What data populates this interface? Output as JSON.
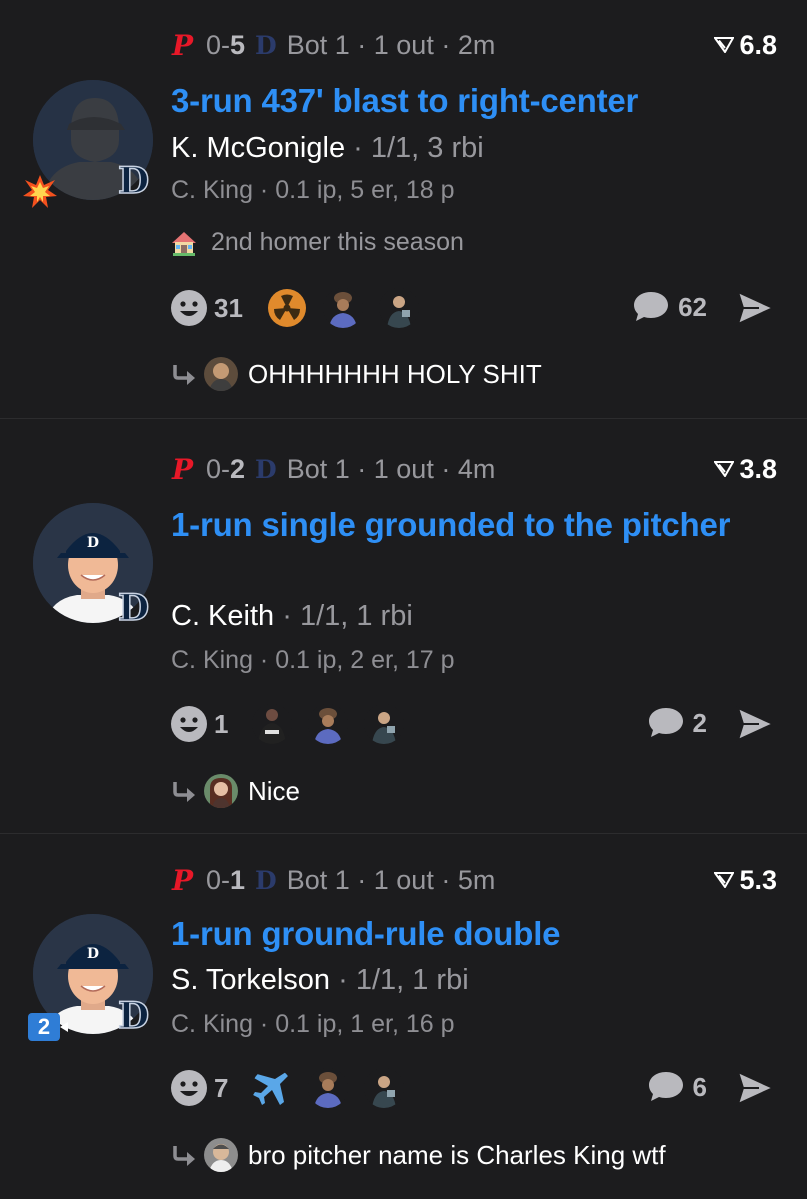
{
  "plays": [
    {
      "score_prefix": "0-",
      "score_bold": "5",
      "situation": "Bot 1 · 1 out · 2m",
      "leverage": "6.8",
      "headline": "3-run 437' blast to right-center",
      "batter": "K. McGonigle",
      "batter_stats": " · 1/1, 3 rbi",
      "pitcher_line": "C. King · 0.1 ip, 5 er, 18 p",
      "note": "2nd homer this season",
      "reaction_count": "31",
      "comment_count": "62",
      "reply_text": "OHHHHHHH HOLY SHIT",
      "avatar": "silhouette",
      "badge": "explosion-icon"
    },
    {
      "score_prefix": "0-",
      "score_bold": "2",
      "situation": "Bot 1 · 1 out · 4m",
      "leverage": "3.8",
      "headline": "1-run single grounded to the pitcher",
      "batter": "C. Keith",
      "batter_stats": " · 1/1, 1 rbi",
      "pitcher_line": "C. King · 0.1 ip, 2 er, 17 p",
      "reaction_count": "1",
      "comment_count": "2",
      "reply_text": "Nice",
      "avatar": "player-photo"
    },
    {
      "score_prefix": "0-",
      "score_bold": "1",
      "situation": "Bot 1 · 1 out · 5m",
      "leverage": "5.3",
      "headline": "1-run ground-rule double",
      "batter": "S. Torkelson",
      "batter_stats": " · 1/1, 1 rbi",
      "pitcher_line": "C. King · 0.1 ip, 1 er, 16 p",
      "reaction_count": "7",
      "comment_count": "6",
      "reply_text": "bro pitcher name is Charles King wtf",
      "avatar": "player-photo",
      "order_badge": "2"
    }
  ],
  "logos": {
    "away": "P",
    "home": "D"
  },
  "colors": {
    "accent": "#2e8ff5",
    "phillies_red": "#e81828",
    "tigers_navy": "#0c2340",
    "background": "#1c1c1e"
  }
}
